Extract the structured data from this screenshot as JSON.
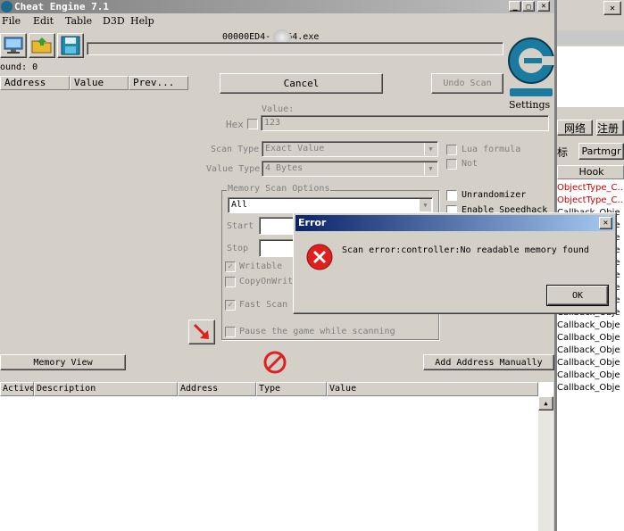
{
  "window": {
    "title": "Cheat Engine 7.1",
    "process_name": "00000ED4-    _x64.exe",
    "menu": [
      "File",
      "Edit",
      "Table",
      "D3D",
      "Help"
    ]
  },
  "scan": {
    "found_label": "ound: 0",
    "columns": [
      "Address",
      "Value",
      "Prev..."
    ],
    "cancel_label": "Cancel",
    "undo_label": "Undo Scan",
    "settings_label": "Settings",
    "value_label": "Value:",
    "hex_label": "Hex",
    "value": "123",
    "scan_type_label": "Scan Type",
    "scan_type_value": "Exact Value",
    "value_type_label": "Value Type",
    "value_type_value": "4 Bytes",
    "lua_formula_label": "Lua formula",
    "not_label": "Not",
    "memory_options_label": "Memory Scan Options",
    "memory_region": "All",
    "start_label": "Start",
    "stop_label": "Stop",
    "writable_label": "Writable",
    "copyonwrite_label": "CopyOnWrit",
    "fastscan_label": "Fast Scan",
    "unrandomizer_label": "Unrandomizer",
    "speedhack_label": "Enable Speedhack",
    "pause_label": "Pause the game while scanning"
  },
  "bottom": {
    "memory_view_label": "Memory View",
    "add_address_label": "Add Address Manually",
    "columns": [
      "Active",
      "Description",
      "Address",
      "Type",
      "Value"
    ]
  },
  "dialog": {
    "title": "Error",
    "close": "✕",
    "message": "Scan error:controller:No readable memory found",
    "ok_label": "OK"
  },
  "right_panel": {
    "tabs_top": [
      "网络",
      "注册"
    ],
    "tabs_second": [
      "标",
      "Partmgr"
    ],
    "hook_header": "Hook",
    "rows": [
      {
        "text": "ObjectType_C...",
        "color": "#cc0000"
      },
      {
        "text": "ObjectType_C...",
        "color": "#cc0000"
      },
      {
        "text": "Callback_Obje",
        "color": "#000000"
      },
      {
        "text": "Callback_Obje",
        "color": "#000000"
      },
      {
        "text": "Callback_Obje",
        "color": "#000000"
      },
      {
        "text": "Callback_Obje",
        "color": "#000000"
      },
      {
        "text": "Callback_Obje",
        "color": "#000000"
      },
      {
        "text": "Callback_Obje",
        "color": "#000000"
      },
      {
        "text": "Callback_Obje",
        "color": "#000000"
      },
      {
        "text": "Callback_Obje",
        "color": "#000000"
      },
      {
        "text": "Callback_Obje",
        "color": "#000000"
      },
      {
        "text": "Callback_Obje",
        "color": "#000000"
      },
      {
        "text": "Callback_Obje",
        "color": "#000000"
      },
      {
        "text": "Callback_Obje",
        "color": "#000000"
      },
      {
        "text": "Callback_Obje",
        "color": "#000000"
      },
      {
        "text": "Callback_Obje",
        "color": "#000000"
      },
      {
        "text": "Callback_Obje",
        "color": "#000000"
      }
    ]
  }
}
